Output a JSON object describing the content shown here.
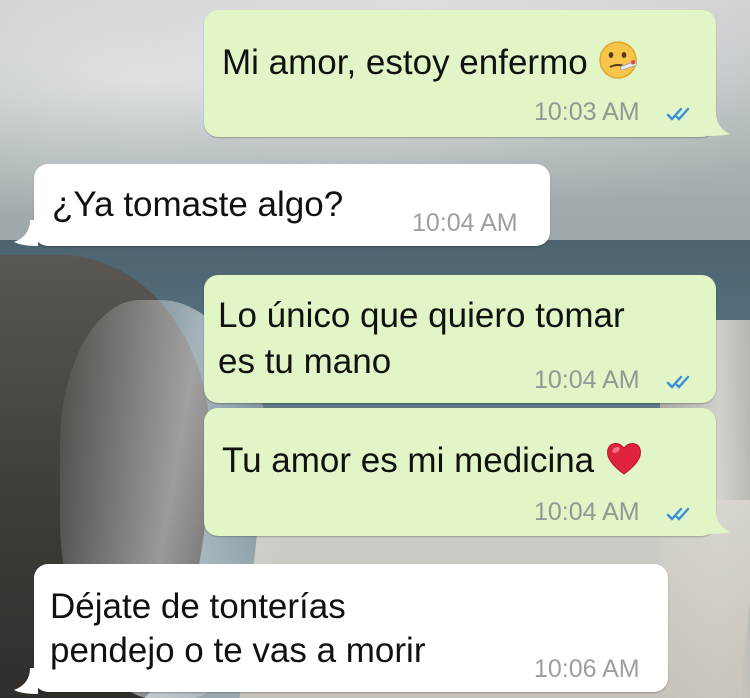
{
  "messages": [
    {
      "direction": "outgoing",
      "text": "Mi amor, estoy enfermo",
      "emoji": "sick-face-emoji",
      "time": "10:03 AM",
      "status": "read-double-check"
    },
    {
      "direction": "incoming",
      "text": "¿Ya tomaste algo?",
      "time": "10:04 AM"
    },
    {
      "direction": "outgoing",
      "line1": "Lo único que quiero tomar",
      "line2": "es tu mano",
      "time": "10:04 AM",
      "status": "read-double-check"
    },
    {
      "direction": "outgoing",
      "text": "Tu amor es mi medicina",
      "emoji": "red-heart-emoji",
      "time": "10:04 AM",
      "status": "read-double-check"
    },
    {
      "direction": "incoming",
      "line1": "Déjate de tonterías",
      "line2": "pendejo o te vas a morir",
      "time": "10:06 AM"
    }
  ],
  "colors": {
    "outgoing_bubble": "#e1f5c6",
    "incoming_bubble": "#ffffff",
    "read_ticks": "#3b8fd9"
  }
}
